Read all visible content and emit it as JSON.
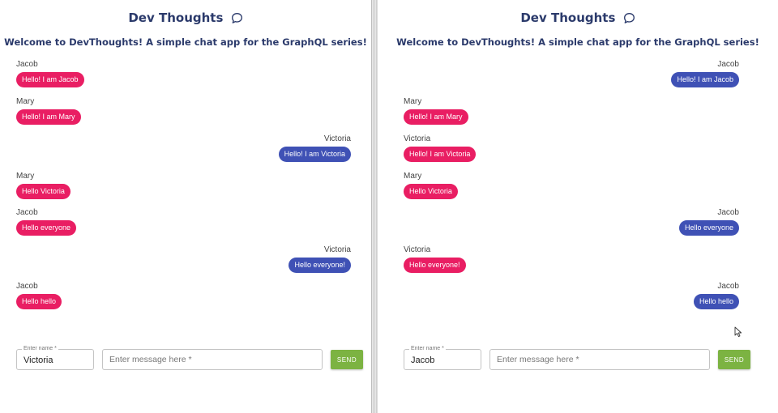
{
  "app_title": "Dev Thoughts",
  "welcome_text": "Welcome to DevThoughts! A simple chat app for the GraphQL series!",
  "colors": {
    "title": "#2b3a6b",
    "own_bubble": "#3f51b5",
    "other_bubble": "#e91e63",
    "send_button": "#7cb342"
  },
  "icons": {
    "title_icon": "chat-bubble-icon"
  },
  "left_pane": {
    "current_user": "Victoria",
    "messages": [
      {
        "sender": "Jacob",
        "text": "Hello! I am Jacob",
        "side": "left"
      },
      {
        "sender": "Mary",
        "text": "Hello! I am Mary",
        "side": "left"
      },
      {
        "sender": "Victoria",
        "text": "Hello! I am Victoria",
        "side": "right"
      },
      {
        "sender": "Mary",
        "text": "Hello Victoria",
        "side": "left"
      },
      {
        "sender": "Jacob",
        "text": "Hello everyone",
        "side": "left"
      },
      {
        "sender": "Victoria",
        "text": "Hello everyone!",
        "side": "right"
      },
      {
        "sender": "Jacob",
        "text": "Hello hello",
        "side": "left"
      }
    ],
    "form": {
      "name_label": "Enter name *",
      "name_value": "Victoria",
      "message_placeholder": "Enter message here *",
      "send_label": "SEND"
    }
  },
  "right_pane": {
    "current_user": "Jacob",
    "messages": [
      {
        "sender": "Jacob",
        "text": "Hello! I am Jacob",
        "side": "right"
      },
      {
        "sender": "Mary",
        "text": "Hello! I am Mary",
        "side": "left"
      },
      {
        "sender": "Victoria",
        "text": "Hello! I am Victoria",
        "side": "left"
      },
      {
        "sender": "Mary",
        "text": "Hello Victoria",
        "side": "left"
      },
      {
        "sender": "Jacob",
        "text": "Hello everyone",
        "side": "right"
      },
      {
        "sender": "Victoria",
        "text": "Hello everyone!",
        "side": "left"
      },
      {
        "sender": "Jacob",
        "text": "Hello hello",
        "side": "right"
      }
    ],
    "form": {
      "name_label": "Enter name *",
      "name_value": "Jacob",
      "message_placeholder": "Enter message here *",
      "send_label": "SEND"
    }
  }
}
